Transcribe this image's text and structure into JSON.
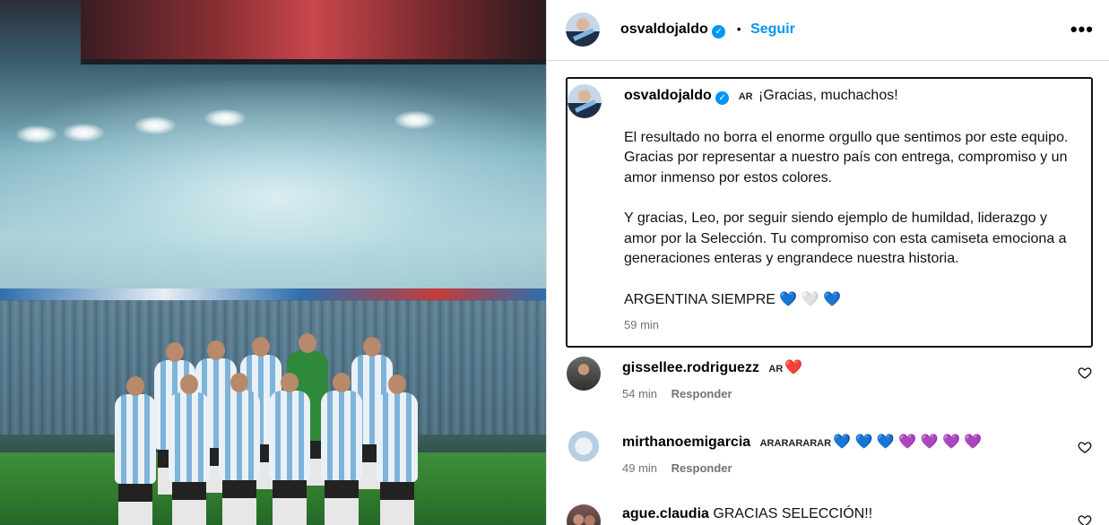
{
  "post": {
    "author": "osvaldojaldo",
    "follow_label": "Seguir",
    "separator": "•",
    "more_label": "•••",
    "verified_mark": "✓"
  },
  "caption": {
    "author": "osvaldojaldo",
    "flag": "AR",
    "headline": "¡Gracias, muchachos!",
    "p1": "El resultado no borra el enorme orgullo que sentimos por este equipo. Gracias por representar a nuestro país con entrega, compromiso y un amor inmenso por estos colores.",
    "p2": "Y gracias, Leo, por seguir siendo ejemplo de humildad, liderazgo y amor por la Selección. Tu compromiso con esta camiseta emociona a generaciones enteras y engrandece nuestra historia.",
    "p3": "ARGENTINA SIEMPRE",
    "p3_emojis": [
      "💙",
      "🤍",
      "💙"
    ],
    "time": "59 min"
  },
  "comments": [
    {
      "user": "gissellee.rodriguezz",
      "text": "AR",
      "emoji": "❤️",
      "time": "54 min",
      "reply_label": "Responder"
    },
    {
      "user": "mirthanoemigarcia",
      "text": "ARARARARAR",
      "emojis": [
        "💙",
        "💙",
        "💙",
        "💜",
        "💜",
        "💜",
        "💜"
      ],
      "time": "49 min",
      "reply_label": "Responder"
    },
    {
      "user": "ague.claudia",
      "text": "GRACIAS SELECCIÓN!!"
    }
  ],
  "icons": {
    "verified": "verified-badge-icon",
    "like": "heart-outline-icon",
    "more": "more-options-icon"
  },
  "colors": {
    "accent": "#0095f6",
    "muted": "#737373",
    "border": "#dbdbdb"
  }
}
